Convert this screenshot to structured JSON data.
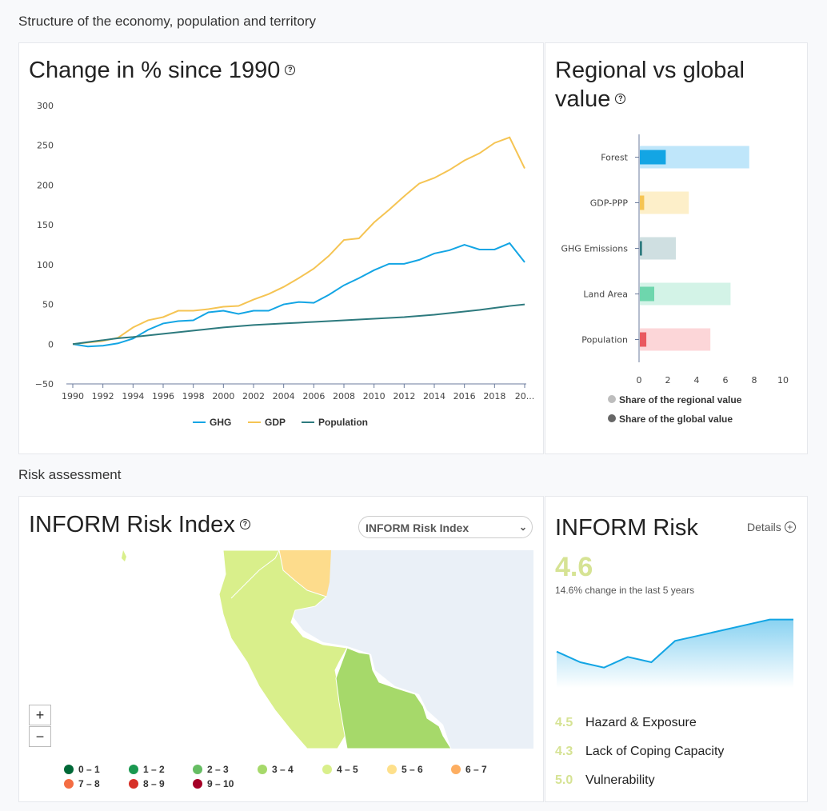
{
  "sections": {
    "structure": "Structure of the economy, population and territory",
    "risk": "Risk assessment"
  },
  "change_card": {
    "title": "Change in % since 1990",
    "legend": [
      "GHG",
      "GDP",
      "Population"
    ]
  },
  "regional_card": {
    "title_line1": "Regional vs global",
    "title_line2": "value",
    "legend_regional": "Share of the regional value",
    "legend_global": "Share of the global value"
  },
  "inform_map_card": {
    "title": "INFORM Risk Index",
    "select_value": "INFORM Risk Index",
    "zoom_in": "+",
    "zoom_out": "−",
    "legend": [
      {
        "label": "0 – 1",
        "color": "#006837"
      },
      {
        "label": "1 – 2",
        "color": "#1a9850"
      },
      {
        "label": "2 – 3",
        "color": "#66bd63"
      },
      {
        "label": "3 – 4",
        "color": "#a6d96a"
      },
      {
        "label": "4 – 5",
        "color": "#d9ef8b"
      },
      {
        "label": "5 – 6",
        "color": "#fee08b"
      },
      {
        "label": "6 – 7",
        "color": "#fdae61"
      },
      {
        "label": "7 – 8",
        "color": "#f46d43"
      },
      {
        "label": "8 – 9",
        "color": "#d73027"
      },
      {
        "label": "9 – 10",
        "color": "#a50026"
      }
    ]
  },
  "inform_risk_card": {
    "title": "INFORM Risk",
    "details": "Details",
    "score": "4.6",
    "change_text": "14.6% change in the last 5 years",
    "trend": [
      4.0,
      3.8,
      3.7,
      3.9,
      3.8,
      4.2,
      4.3,
      4.4,
      4.5,
      4.6,
      4.6
    ],
    "sub_scores": [
      {
        "value": "4.5",
        "label": "Hazard & Exposure"
      },
      {
        "value": "4.3",
        "label": "Lack of Coping Capacity"
      },
      {
        "value": "5.0",
        "label": "Vulnerability"
      }
    ]
  },
  "chart_data": [
    {
      "type": "line",
      "title": "Change in % since 1990",
      "x": [
        1990,
        1991,
        1992,
        1993,
        1994,
        1995,
        1996,
        1997,
        1998,
        1999,
        2000,
        2001,
        2002,
        2003,
        2004,
        2005,
        2006,
        2007,
        2008,
        2009,
        2010,
        2011,
        2012,
        2013,
        2014,
        2015,
        2016,
        2017,
        2018,
        2019,
        2020
      ],
      "x_tick_labels": [
        "1990",
        "1992",
        "1994",
        "1996",
        "1998",
        "2000",
        "2002",
        "2004",
        "2006",
        "2008",
        "2010",
        "2012",
        "2014",
        "2016",
        "2018",
        "20..."
      ],
      "ylim": [
        -50,
        300
      ],
      "y_ticks": [
        -50,
        0,
        50,
        100,
        150,
        200,
        250,
        300
      ],
      "series": [
        {
          "name": "GHG",
          "color": "#13a5e4",
          "values": [
            0,
            -3,
            -2,
            1,
            7,
            18,
            26,
            29,
            30,
            40,
            42,
            38,
            42,
            42,
            50,
            53,
            52,
            62,
            74,
            83,
            93,
            101,
            101,
            106,
            114,
            118,
            125,
            119,
            119,
            127,
            103
          ]
        },
        {
          "name": "GDP",
          "color": "#f5c453",
          "values": [
            0,
            2,
            4,
            8,
            21,
            30,
            34,
            42,
            42,
            44,
            47,
            48,
            56,
            63,
            72,
            83,
            95,
            111,
            131,
            133,
            153,
            169,
            186,
            202,
            209,
            219,
            231,
            240,
            253,
            260,
            221
          ]
        },
        {
          "name": "Population",
          "color": "#2d7a7e",
          "values": [
            0,
            2.5,
            5,
            7.5,
            9,
            11,
            13,
            15,
            17,
            19,
            21,
            22.5,
            24,
            25,
            26,
            27,
            28,
            29,
            30,
            31,
            32,
            33,
            34,
            35.5,
            37,
            39,
            41,
            43,
            45.5,
            48,
            50
          ]
        }
      ],
      "legend_position": "bottom",
      "grid": false
    },
    {
      "type": "bar",
      "title": "Regional vs global value",
      "categories": [
        "Forest",
        "GDP-PPP",
        "GHG Emissions",
        "Land Area",
        "Population"
      ],
      "xlim": [
        0,
        10
      ],
      "x_ticks": [
        0,
        2,
        4,
        6,
        8,
        10
      ],
      "series": [
        {
          "name": "Share of the regional value",
          "values": [
            7.6,
            3.4,
            2.5,
            6.3,
            4.9
          ]
        },
        {
          "name": "Share of the global value",
          "values": [
            1.8,
            0.3,
            0.15,
            1.0,
            0.45
          ]
        }
      ],
      "colors_regional": [
        "#bfe6fa",
        "#fdefc9",
        "#cfdfe1",
        "#d3f3e7",
        "#fcd6d8"
      ],
      "colors_global": [
        "#13a5e4",
        "#f5c453",
        "#2d7a7e",
        "#6ed6ad",
        "#e9595f"
      ],
      "legend_position": "bottom"
    }
  ]
}
